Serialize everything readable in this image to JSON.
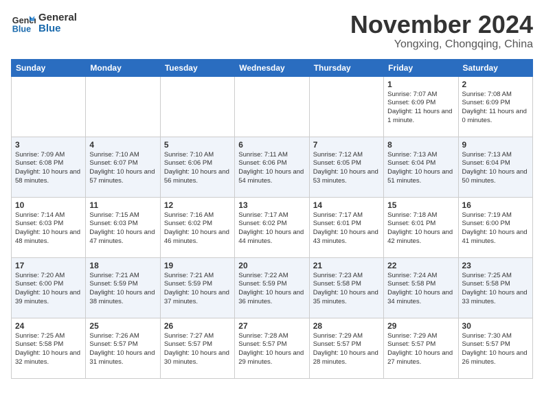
{
  "header": {
    "logo_line1": "General",
    "logo_line2": "Blue",
    "month": "November 2024",
    "location": "Yongxing, Chongqing, China"
  },
  "weekdays": [
    "Sunday",
    "Monday",
    "Tuesday",
    "Wednesday",
    "Thursday",
    "Friday",
    "Saturday"
  ],
  "weeks": [
    [
      {
        "day": "",
        "info": ""
      },
      {
        "day": "",
        "info": ""
      },
      {
        "day": "",
        "info": ""
      },
      {
        "day": "",
        "info": ""
      },
      {
        "day": "",
        "info": ""
      },
      {
        "day": "1",
        "info": "Sunrise: 7:07 AM\nSunset: 6:09 PM\nDaylight: 11 hours and 1 minute."
      },
      {
        "day": "2",
        "info": "Sunrise: 7:08 AM\nSunset: 6:09 PM\nDaylight: 11 hours and 0 minutes."
      }
    ],
    [
      {
        "day": "3",
        "info": "Sunrise: 7:09 AM\nSunset: 6:08 PM\nDaylight: 10 hours and 58 minutes."
      },
      {
        "day": "4",
        "info": "Sunrise: 7:10 AM\nSunset: 6:07 PM\nDaylight: 10 hours and 57 minutes."
      },
      {
        "day": "5",
        "info": "Sunrise: 7:10 AM\nSunset: 6:06 PM\nDaylight: 10 hours and 56 minutes."
      },
      {
        "day": "6",
        "info": "Sunrise: 7:11 AM\nSunset: 6:06 PM\nDaylight: 10 hours and 54 minutes."
      },
      {
        "day": "7",
        "info": "Sunrise: 7:12 AM\nSunset: 6:05 PM\nDaylight: 10 hours and 53 minutes."
      },
      {
        "day": "8",
        "info": "Sunrise: 7:13 AM\nSunset: 6:04 PM\nDaylight: 10 hours and 51 minutes."
      },
      {
        "day": "9",
        "info": "Sunrise: 7:13 AM\nSunset: 6:04 PM\nDaylight: 10 hours and 50 minutes."
      }
    ],
    [
      {
        "day": "10",
        "info": "Sunrise: 7:14 AM\nSunset: 6:03 PM\nDaylight: 10 hours and 48 minutes."
      },
      {
        "day": "11",
        "info": "Sunrise: 7:15 AM\nSunset: 6:03 PM\nDaylight: 10 hours and 47 minutes."
      },
      {
        "day": "12",
        "info": "Sunrise: 7:16 AM\nSunset: 6:02 PM\nDaylight: 10 hours and 46 minutes."
      },
      {
        "day": "13",
        "info": "Sunrise: 7:17 AM\nSunset: 6:02 PM\nDaylight: 10 hours and 44 minutes."
      },
      {
        "day": "14",
        "info": "Sunrise: 7:17 AM\nSunset: 6:01 PM\nDaylight: 10 hours and 43 minutes."
      },
      {
        "day": "15",
        "info": "Sunrise: 7:18 AM\nSunset: 6:01 PM\nDaylight: 10 hours and 42 minutes."
      },
      {
        "day": "16",
        "info": "Sunrise: 7:19 AM\nSunset: 6:00 PM\nDaylight: 10 hours and 41 minutes."
      }
    ],
    [
      {
        "day": "17",
        "info": "Sunrise: 7:20 AM\nSunset: 6:00 PM\nDaylight: 10 hours and 39 minutes."
      },
      {
        "day": "18",
        "info": "Sunrise: 7:21 AM\nSunset: 5:59 PM\nDaylight: 10 hours and 38 minutes."
      },
      {
        "day": "19",
        "info": "Sunrise: 7:21 AM\nSunset: 5:59 PM\nDaylight: 10 hours and 37 minutes."
      },
      {
        "day": "20",
        "info": "Sunrise: 7:22 AM\nSunset: 5:59 PM\nDaylight: 10 hours and 36 minutes."
      },
      {
        "day": "21",
        "info": "Sunrise: 7:23 AM\nSunset: 5:58 PM\nDaylight: 10 hours and 35 minutes."
      },
      {
        "day": "22",
        "info": "Sunrise: 7:24 AM\nSunset: 5:58 PM\nDaylight: 10 hours and 34 minutes."
      },
      {
        "day": "23",
        "info": "Sunrise: 7:25 AM\nSunset: 5:58 PM\nDaylight: 10 hours and 33 minutes."
      }
    ],
    [
      {
        "day": "24",
        "info": "Sunrise: 7:25 AM\nSunset: 5:58 PM\nDaylight: 10 hours and 32 minutes."
      },
      {
        "day": "25",
        "info": "Sunrise: 7:26 AM\nSunset: 5:57 PM\nDaylight: 10 hours and 31 minutes."
      },
      {
        "day": "26",
        "info": "Sunrise: 7:27 AM\nSunset: 5:57 PM\nDaylight: 10 hours and 30 minutes."
      },
      {
        "day": "27",
        "info": "Sunrise: 7:28 AM\nSunset: 5:57 PM\nDaylight: 10 hours and 29 minutes."
      },
      {
        "day": "28",
        "info": "Sunrise: 7:29 AM\nSunset: 5:57 PM\nDaylight: 10 hours and 28 minutes."
      },
      {
        "day": "29",
        "info": "Sunrise: 7:29 AM\nSunset: 5:57 PM\nDaylight: 10 hours and 27 minutes."
      },
      {
        "day": "30",
        "info": "Sunrise: 7:30 AM\nSunset: 5:57 PM\nDaylight: 10 hours and 26 minutes."
      }
    ]
  ]
}
